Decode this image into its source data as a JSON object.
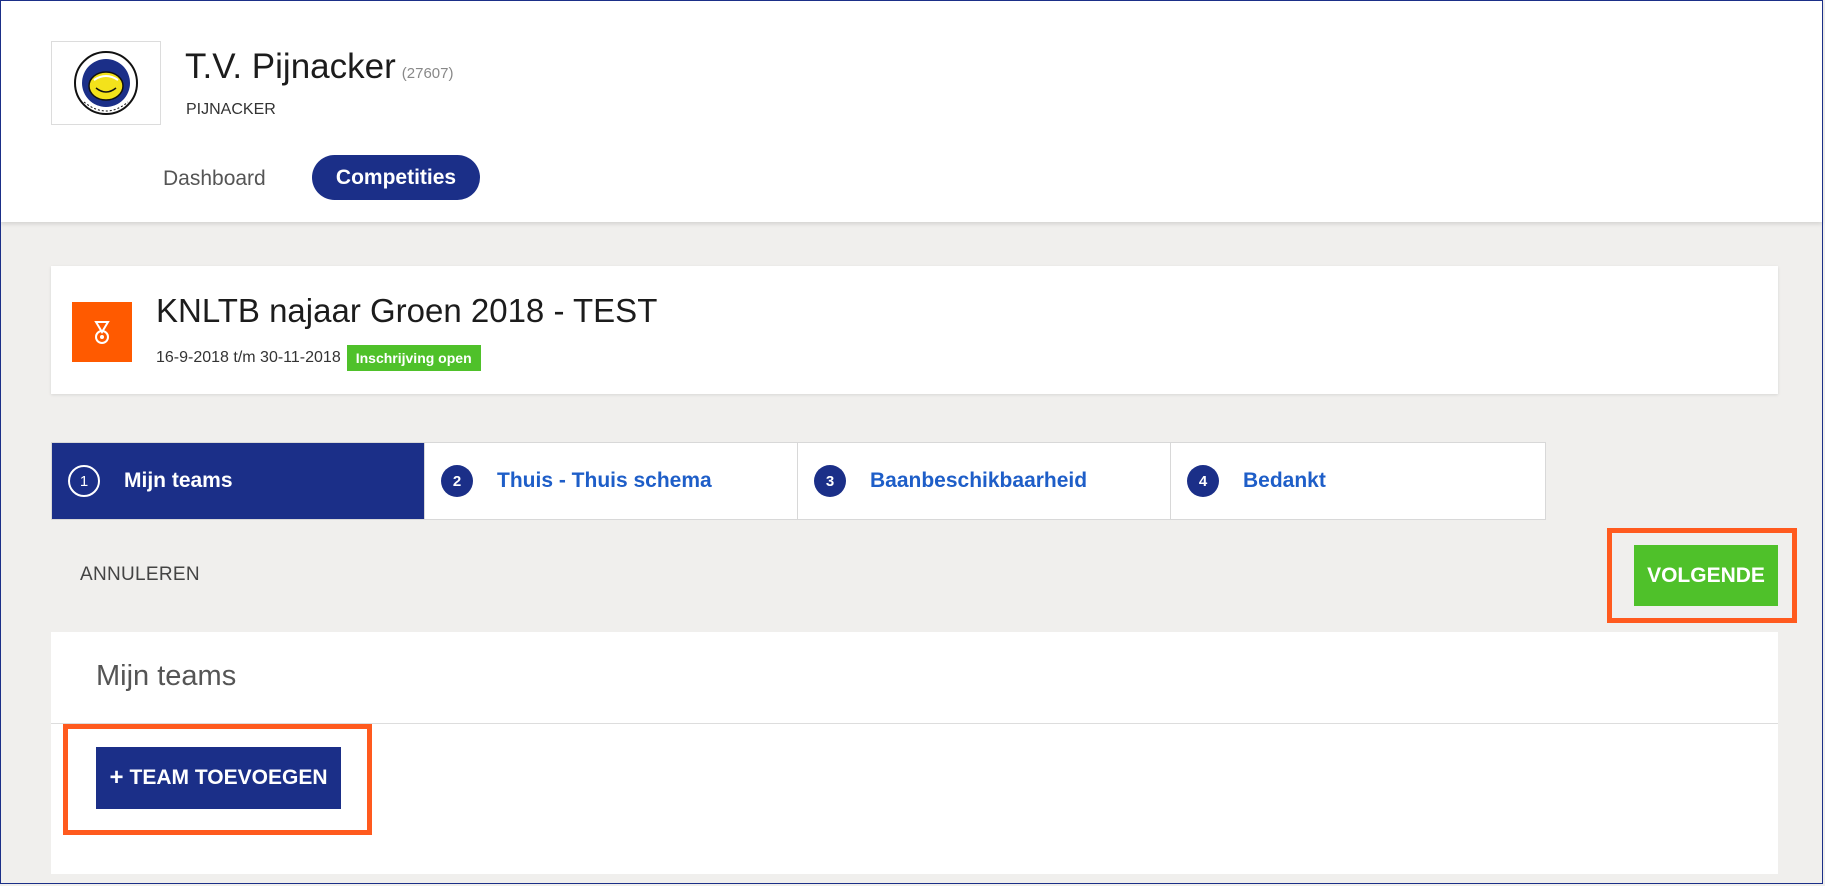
{
  "club": {
    "name": "T.V. Pijnacker",
    "id": "(27607)",
    "city": "PIJNACKER",
    "logo_icon": "club-logo"
  },
  "nav": {
    "dashboard": "Dashboard",
    "competities": "Competities"
  },
  "competition": {
    "title": "KNLTB najaar Groen 2018 - TEST",
    "dates": "16-9-2018 t/m 30-11-2018",
    "status": "Inschrijving open",
    "icon": "medal-icon",
    "accent": "#ff5a00"
  },
  "steps": [
    {
      "num": "1",
      "label": "Mijn teams"
    },
    {
      "num": "2",
      "label": "Thuis - Thuis schema"
    },
    {
      "num": "3",
      "label": "Baanbeschikbaarheid"
    },
    {
      "num": "4",
      "label": "Bedankt"
    }
  ],
  "actions": {
    "cancel": "ANNULEREN",
    "next": "VOLGENDE"
  },
  "teams": {
    "title": "Mijn teams",
    "add_icon": "+",
    "add_label": "TEAM TOEVOEGEN"
  },
  "colors": {
    "primary": "#1b2f88",
    "success": "#4fc12a",
    "highlight": "#ff5a1e"
  }
}
